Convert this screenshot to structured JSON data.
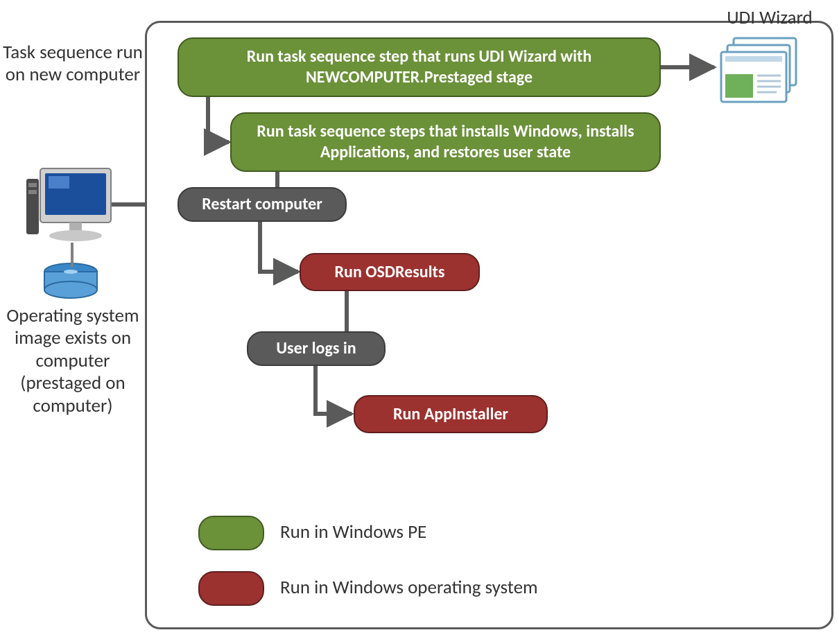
{
  "labels": {
    "udi_wizard": "UDI Wizard",
    "task_sequence_run": "Task sequence run on new computer",
    "os_image_exists": "Operating system image exists on computer (prestaged on computer)"
  },
  "nodes": {
    "step1": "Run task sequence step  that runs UDI Wizard with NEWCOMPUTER.Prestaged  stage",
    "step2": "Run task sequence steps that installs Windows, installs Applications, and restores user state",
    "restart": "Restart computer",
    "osdresults": "Run OSDResults",
    "userlogs": "User logs in",
    "appinstaller": "Run AppInstaller"
  },
  "legend": {
    "pe": "Run in Windows  PE",
    "os": "Run in Windows operating system"
  },
  "icons": {
    "computer": "computer-icon",
    "disk": "disk-icon",
    "wizard": "wizard-windows-icon"
  }
}
